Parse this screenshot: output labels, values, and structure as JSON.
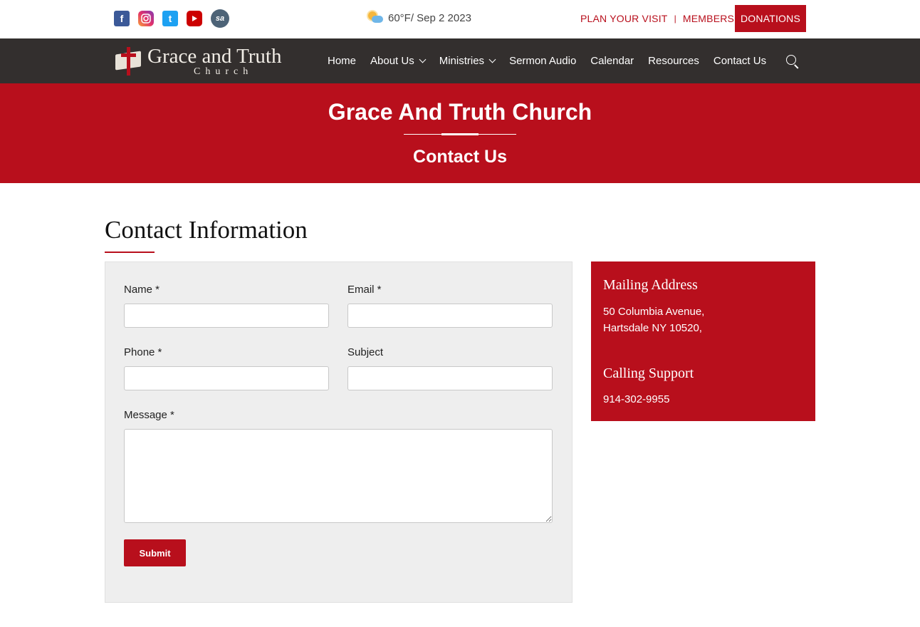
{
  "social": {
    "facebook": "f",
    "twitter": "t",
    "sermonaudio": "sa"
  },
  "weather": {
    "text": "60°F/ Sep 2 2023"
  },
  "toplinks": {
    "plan_visit": "PLAN YOUR VISIT",
    "separator": "|",
    "members": "MEMBERS",
    "donations": "DONATIONS"
  },
  "logo": {
    "title": "Grace and Truth",
    "subtitle": "Church"
  },
  "nav": {
    "items": [
      {
        "label": "Home"
      },
      {
        "label": "About Us"
      },
      {
        "label": "Ministries"
      },
      {
        "label": "Sermon Audio"
      },
      {
        "label": "Calendar"
      },
      {
        "label": "Resources"
      },
      {
        "label": "Contact Us"
      }
    ]
  },
  "banner": {
    "title": "Grace And Truth Church",
    "subtitle": "Contact Us"
  },
  "section": {
    "title": "Contact Information"
  },
  "form": {
    "name_label": "Name *",
    "email_label": "Email *",
    "phone_label": "Phone *",
    "subject_label": "Subject",
    "message_label": "Message *",
    "name_value": "",
    "email_value": "",
    "phone_value": "",
    "subject_value": "",
    "message_value": "",
    "submit_label": "Submit"
  },
  "info": {
    "mailing_heading": "Mailing Address",
    "address_line1": "50 Columbia Avenue,",
    "address_line2": "Hartsdale NY 10520,",
    "calling_heading": "Calling Support",
    "phone": "914-302-9955"
  },
  "colors": {
    "brand_red": "#b80f1c",
    "nav_dark": "#332f2e",
    "panel_gray": "#eeeeee"
  }
}
